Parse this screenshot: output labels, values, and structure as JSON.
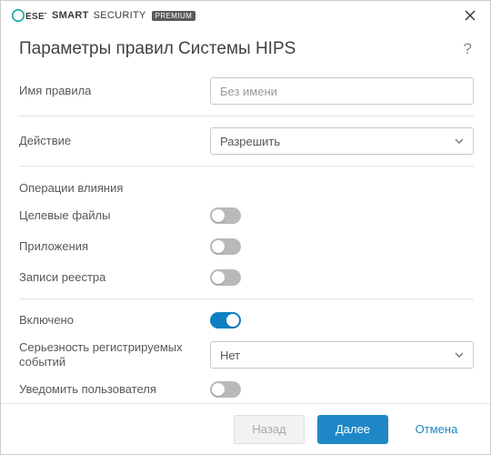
{
  "brand": {
    "name": "ESET",
    "product1": "SMART",
    "product2": "SECURITY",
    "badge": "PREMIUM"
  },
  "header": {
    "title": "Параметры правил Системы HIPS"
  },
  "fields": {
    "rule_name_label": "Имя правила",
    "rule_name_placeholder": "Без имени",
    "rule_name_value": "",
    "action_label": "Действие",
    "action_value": "Разрешить",
    "operations_section": "Операции влияния",
    "target_files_label": "Целевые файлы",
    "applications_label": "Приложения",
    "registry_label": "Записи реестра",
    "enabled_label": "Включено",
    "severity_label": "Серьезность регистрируемых событий",
    "severity_value": "Нет",
    "notify_label": "Уведомить пользователя"
  },
  "toggles": {
    "target_files": false,
    "applications": false,
    "registry": false,
    "enabled": true,
    "notify": false
  },
  "footer": {
    "back": "Назад",
    "next": "Далее",
    "cancel": "Отмена"
  }
}
